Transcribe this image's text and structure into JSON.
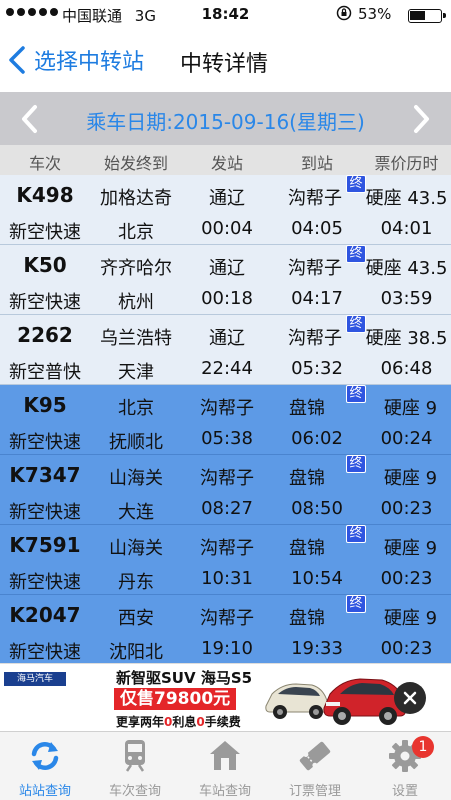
{
  "status_bar": {
    "carrier": "中国联通",
    "network": "3G",
    "time": "18:42",
    "battery": "53%",
    "battery_level": 0.53,
    "lock_icon": "rotation-lock-icon"
  },
  "nav": {
    "back_label": "选择中转站",
    "title": "中转详情"
  },
  "date_bar": {
    "label": "乘车日期:2015-09-16(星期三)"
  },
  "table": {
    "headers": [
      "车次",
      "始发终到",
      "发站",
      "到站",
      "票价历时"
    ],
    "end_badge": "终",
    "rows": [
      {
        "code": "K498",
        "type": "新空快速",
        "origin": "加格达奇",
        "terminal": "北京",
        "from": "通辽",
        "dep": "00:04",
        "to": "沟帮子",
        "arr": "04:05",
        "fare": "硬座 43.5",
        "duration": "04:01",
        "style": "light"
      },
      {
        "code": "K50",
        "type": "新空快速",
        "origin": "齐齐哈尔",
        "terminal": "杭州",
        "from": "通辽",
        "dep": "00:18",
        "to": "沟帮子",
        "arr": "04:17",
        "fare": "硬座 43.5",
        "duration": "03:59",
        "style": "light"
      },
      {
        "code": "2262",
        "type": "新空普快",
        "origin": "乌兰浩特",
        "terminal": "天津",
        "from": "通辽",
        "dep": "22:44",
        "to": "沟帮子",
        "arr": "05:32",
        "fare": "硬座 38.5",
        "duration": "06:48",
        "style": "light"
      },
      {
        "code": "K95",
        "type": "新空快速",
        "origin": "北京",
        "terminal": "抚顺北",
        "from": "沟帮子",
        "dep": "05:38",
        "to": "盘锦",
        "arr": "06:02",
        "fare": "硬座 9",
        "duration": "00:24",
        "style": "blue"
      },
      {
        "code": "K7347",
        "type": "新空快速",
        "origin": "山海关",
        "terminal": "大连",
        "from": "沟帮子",
        "dep": "08:27",
        "to": "盘锦",
        "arr": "08:50",
        "fare": "硬座 9",
        "duration": "00:23",
        "style": "blue"
      },
      {
        "code": "K7591",
        "type": "新空快速",
        "origin": "山海关",
        "terminal": "丹东",
        "from": "沟帮子",
        "dep": "10:31",
        "to": "盘锦",
        "arr": "10:54",
        "fare": "硬座 9",
        "duration": "00:23",
        "style": "blue"
      },
      {
        "code": "K2047",
        "type": "新空快速",
        "origin": "西安",
        "terminal": "沈阳北",
        "from": "沟帮子",
        "dep": "19:10",
        "to": "盘锦",
        "arr": "19:33",
        "fare": "硬座 9",
        "duration": "00:23",
        "style": "blue"
      }
    ]
  },
  "ad": {
    "brand": "海马汽车",
    "headline": "新智驱SUV 海马S5",
    "price": "仅售79800元",
    "sub_1": "更享两年",
    "sub_zero_1": "0",
    "sub_2": "利息",
    "sub_zero_2": "0",
    "sub_3": "手续费"
  },
  "tabs": [
    {
      "label": "站站查询",
      "icon": "refresh-arrows-icon",
      "active": true
    },
    {
      "label": "车次查询",
      "icon": "train-icon",
      "active": false
    },
    {
      "label": "车站查询",
      "icon": "station-house-icon",
      "active": false
    },
    {
      "label": "订票管理",
      "icon": "ticket-icon",
      "active": false
    },
    {
      "label": "设置",
      "icon": "gear-icon",
      "active": false,
      "badge": "1"
    }
  ],
  "colors": {
    "accent": "#2a87e8",
    "row_light": "#e7eef7",
    "row_blue": "#5d9ae6",
    "end_badge": "#2f55e0",
    "badge_red": "#e8352f"
  }
}
